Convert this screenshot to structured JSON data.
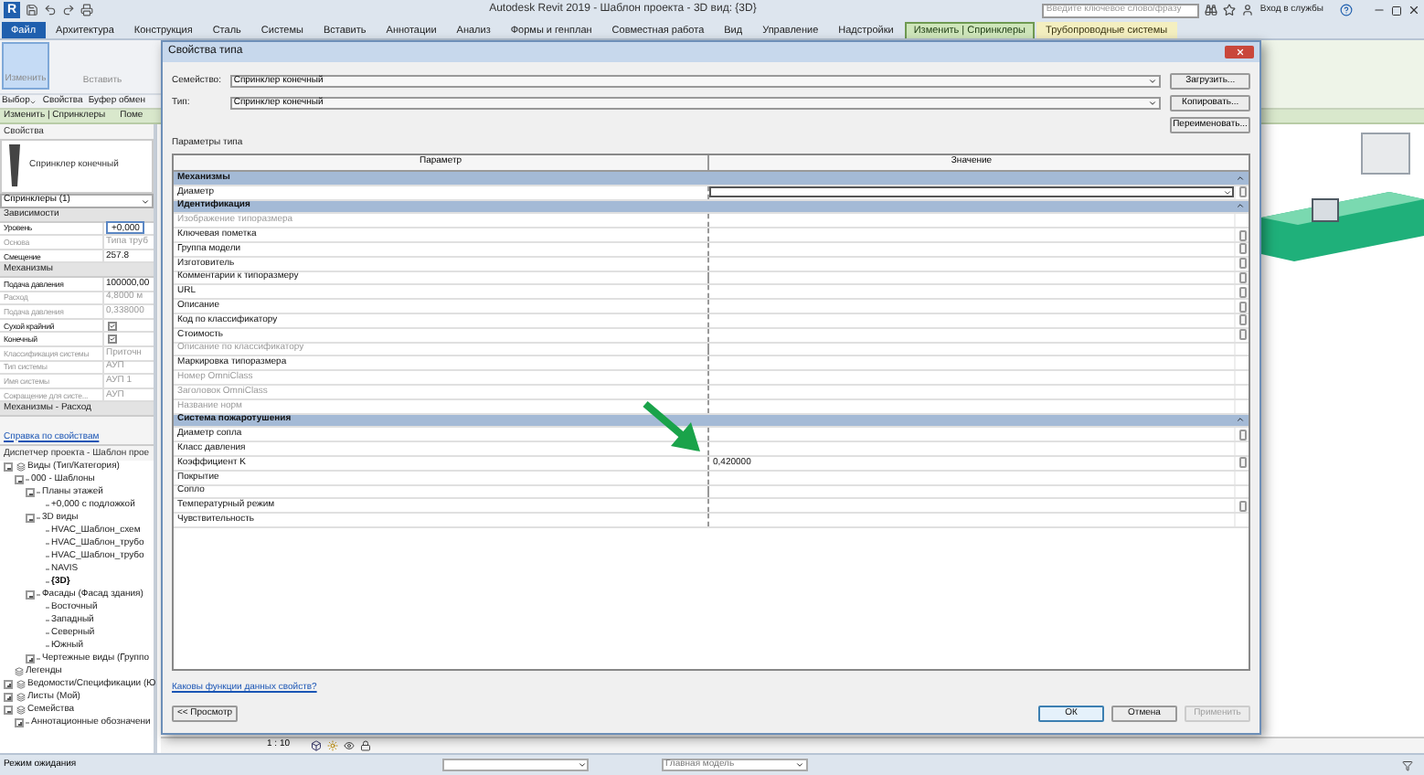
{
  "app": {
    "logo": "R",
    "title": "Autodesk Revit 2019 - Шаблон проекта - 3D вид: {3D}",
    "search": {
      "placeholder": "Введите ключевое слово/фразу"
    },
    "sign_in": "Вход в службы"
  },
  "ribbon_tabs": [
    {
      "label": "Файл",
      "kind": "file",
      "selected": false
    },
    {
      "label": "Архитектура",
      "kind": "tab",
      "selected": false
    },
    {
      "label": "Конструкция",
      "kind": "tab",
      "selected": false
    },
    {
      "label": "Сталь",
      "kind": "tab",
      "selected": false
    },
    {
      "label": "Системы",
      "kind": "tab",
      "selected": false
    },
    {
      "label": "Вставить",
      "kind": "tab",
      "selected": false
    },
    {
      "label": "Аннотации",
      "kind": "tab",
      "selected": false
    },
    {
      "label": "Анализ",
      "kind": "tab",
      "selected": false
    },
    {
      "label": "Формы и генплан",
      "kind": "tab",
      "selected": false
    },
    {
      "label": "Совместная работа",
      "kind": "tab",
      "selected": false
    },
    {
      "label": "Вид",
      "kind": "tab",
      "selected": false
    },
    {
      "label": "Управление",
      "kind": "tab",
      "selected": false
    },
    {
      "label": "Надстройки",
      "kind": "tab",
      "selected": false
    },
    {
      "label": "Изменить | Спринклеры",
      "kind": "context",
      "selected": true
    },
    {
      "label": "Трубопроводные системы",
      "kind": "contextual",
      "selected": false
    }
  ],
  "ribbon": {
    "buttons": [
      {
        "label": "Изменить",
        "selected": true
      },
      {
        "label": "Вставить",
        "selected": false
      }
    ],
    "panels": [
      {
        "label": "Выбор",
        "dropdown": true
      },
      {
        "label": "Свойства",
        "dropdown": false
      },
      {
        "label": "Буфер обмен",
        "dropdown": false
      }
    ]
  },
  "context_bar": [
    "Изменить | Спринклеры",
    "Поме"
  ],
  "properties": {
    "title": "Свойства",
    "family": "Спринклер конечный",
    "selector": "Спринклеры (1)",
    "groups": [
      {
        "name": "Зависимости",
        "rows": [
          {
            "label": "Уровень",
            "value": "+0,000",
            "kind": "field",
            "disabled": false
          },
          {
            "label": "Основа",
            "value": "Типа труб",
            "kind": "text",
            "disabled": true
          },
          {
            "label": "Смещение",
            "value": "257.8",
            "kind": "text",
            "disabled": false
          }
        ]
      },
      {
        "name": "Механизмы",
        "rows": [
          {
            "label": "Подача давления",
            "value": "100000,00",
            "kind": "text",
            "disabled": false
          },
          {
            "label": "Расход",
            "value": "4,8000 м",
            "kind": "text",
            "disabled": true
          },
          {
            "label": "Подача давления",
            "value": "0,338000",
            "kind": "text",
            "disabled": true
          },
          {
            "label": "Сухой крайний",
            "kind": "check",
            "checked": true,
            "disabled": false
          },
          {
            "label": "Конечный",
            "kind": "check",
            "checked": true,
            "disabled": false
          },
          {
            "label": "Классификация системы",
            "value": "Приточн",
            "kind": "text",
            "disabled": true
          },
          {
            "label": "Тип системы",
            "value": "АУП",
            "kind": "text",
            "disabled": true
          },
          {
            "label": "Имя системы",
            "value": "АУП 1",
            "kind": "text",
            "disabled": true
          },
          {
            "label": "Сокращение для систе...",
            "value": "АУП",
            "kind": "text",
            "disabled": true
          }
        ]
      },
      {
        "name": "Механизмы - Расход"
      }
    ],
    "help_link": "Справка по свойствам"
  },
  "project_browser": {
    "title": "Диспетчер проекта - Шаблон прое",
    "tree": [
      {
        "label": "Виды (Тип/Категория)",
        "expanded": true,
        "selected": false,
        "children": [
          {
            "label": "000 - Шаблоны",
            "expanded": true,
            "selected": false,
            "children": [
              {
                "label": "Планы этажей",
                "expanded": true,
                "selected": false,
                "children": [
                  {
                    "label": "+0,000 с подложкой",
                    "selected": false
                  }
                ]
              },
              {
                "label": "3D виды",
                "expanded": true,
                "selected": false,
                "children": [
                  {
                    "label": "HVAC_Шаблон_схем",
                    "selected": false
                  },
                  {
                    "label": "HVAC_Шаблон_трубо",
                    "selected": false
                  },
                  {
                    "label": "HVAC_Шаблон_трубо",
                    "selected": false
                  },
                  {
                    "label": "NAVIS",
                    "selected": false
                  },
                  {
                    "label": "{3D}",
                    "selected": true
                  }
                ]
              },
              {
                "label": "Фасады (Фасад здания)",
                "expanded": true,
                "selected": false,
                "children": [
                  {
                    "label": "Восточный",
                    "selected": false
                  },
                  {
                    "label": "Западный",
                    "selected": false
                  },
                  {
                    "label": "Северный",
                    "selected": false
                  },
                  {
                    "label": "Южный",
                    "selected": false
                  }
                ]
              },
              {
                "label": "Чертежные виды (Группо",
                "expanded": false,
                "selected": false
              }
            ]
          }
        ]
      },
      {
        "label": "Легенды",
        "selected": false
      },
      {
        "label": "Ведомости/Спецификации (Ю",
        "expanded": false,
        "selected": false
      },
      {
        "label": "Листы (Мой)",
        "expanded": false,
        "selected": false
      },
      {
        "label": "Семейства",
        "expanded": true,
        "selected": false,
        "children": [
          {
            "label": "Аннотационные обозначени",
            "expanded": false,
            "selected": false
          }
        ]
      }
    ]
  },
  "dialog": {
    "title": "Свойства типа",
    "fields": [
      {
        "label": "Семейство:",
        "value": "Спринклер конечный"
      },
      {
        "label": "Тип:",
        "value": "Спринклер конечный"
      }
    ],
    "side_buttons": [
      "Загрузить...",
      "Копировать...",
      "Переименовать..."
    ],
    "section": "Параметры типа",
    "columns": [
      "Параметр",
      "Значение"
    ],
    "groups": [
      {
        "name": "Механизмы",
        "expanded": true,
        "params": [
          {
            "name": "Диаметр",
            "kind": "dropdown",
            "disabled": false,
            "edit_button": true
          }
        ]
      },
      {
        "name": "Идентификация",
        "expanded": true,
        "params": [
          {
            "name": "Изображение типоразмера",
            "kind": "text",
            "disabled": true,
            "edit_button": false
          },
          {
            "name": "Ключевая пометка",
            "kind": "text",
            "disabled": false,
            "edit_button": true
          },
          {
            "name": "Группа модели",
            "kind": "text",
            "disabled": false,
            "edit_button": true
          },
          {
            "name": "Изготовитель",
            "kind": "text",
            "disabled": false,
            "edit_button": true
          },
          {
            "name": "Комментарии к типоразмеру",
            "kind": "text",
            "disabled": false,
            "edit_button": true
          },
          {
            "name": "URL",
            "kind": "text",
            "disabled": false,
            "edit_button": true
          },
          {
            "name": "Описание",
            "kind": "text",
            "disabled": false,
            "edit_button": true
          },
          {
            "name": "Код по классификатору",
            "kind": "text",
            "disabled": false,
            "edit_button": true
          },
          {
            "name": "Стоимость",
            "kind": "text",
            "disabled": false,
            "edit_button": true
          },
          {
            "name": "Описание по классификатору",
            "kind": "text",
            "disabled": true,
            "edit_button": false
          },
          {
            "name": "Маркировка типоразмера",
            "kind": "text",
            "disabled": false,
            "edit_button": false
          },
          {
            "name": "Номер OmniClass",
            "kind": "text",
            "disabled": true,
            "edit_button": false
          },
          {
            "name": "Заголовок OmniClass",
            "kind": "text",
            "disabled": true,
            "edit_button": false
          },
          {
            "name": "Название норм",
            "kind": "text",
            "disabled": true,
            "edit_button": false
          }
        ]
      },
      {
        "name": "Система пожаротушения",
        "expanded": true,
        "params": [
          {
            "name": "Диаметр сопла",
            "kind": "text",
            "disabled": false,
            "edit_button": true
          },
          {
            "name": "Класс давления",
            "kind": "text",
            "disabled": false,
            "edit_button": false
          },
          {
            "name": "Коэффициент K",
            "kind": "text",
            "value": "0,420000",
            "disabled": false,
            "edit_button": true
          },
          {
            "name": "Покрытие",
            "kind": "text",
            "disabled": false,
            "edit_button": false
          },
          {
            "name": "Сопло",
            "kind": "text",
            "disabled": false,
            "edit_button": false
          },
          {
            "name": "Температурный режим",
            "kind": "text",
            "disabled": false,
            "edit_button": true
          },
          {
            "name": "Чувствительность",
            "kind": "text",
            "disabled": false,
            "edit_button": false
          }
        ]
      }
    ],
    "help_link": "Каковы функции данных свойств?",
    "buttons": [
      {
        "label": "<< Просмотр",
        "default": false,
        "disabled": false
      },
      {
        "label": "ОК",
        "default": true,
        "disabled": false
      },
      {
        "label": "Отмена",
        "default": false,
        "disabled": false
      },
      {
        "label": "Применить",
        "default": false,
        "disabled": true
      }
    ]
  },
  "view_bar": {
    "scale": "1 : 10"
  },
  "status_bar": {
    "text": "Режим ожидания",
    "model": "Главная модель"
  }
}
